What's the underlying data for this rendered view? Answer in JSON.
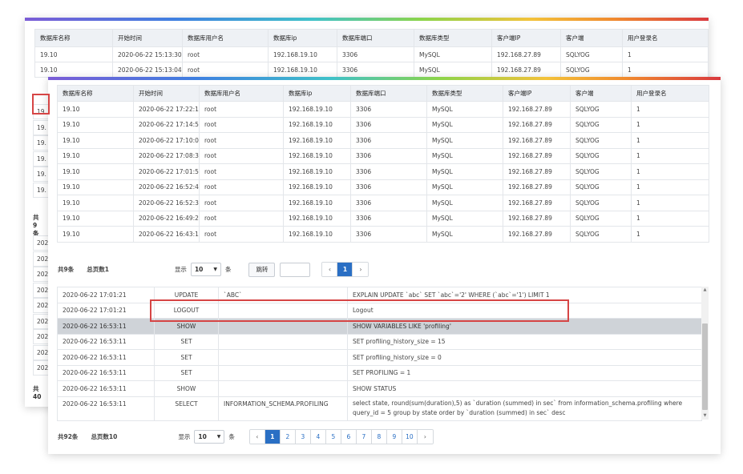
{
  "back_table": {
    "headers": [
      "数据库名称",
      "开始时间",
      "数据库用户名",
      "数据库ip",
      "数据库端口",
      "数据库类型",
      "客户端IP",
      "客户端",
      "用户登录名"
    ],
    "rows": [
      [
        "19.10",
        "2020-06-22 15:13:30",
        "root",
        "192.168.19.10",
        "3306",
        "MySQL",
        "192.168.27.89",
        "SQLYOG",
        "1"
      ],
      [
        "19.10",
        "2020-06-22 15:13:04",
        "root",
        "192.168.19.10",
        "3306",
        "MySQL",
        "192.168.27.89",
        "SQLYOG",
        "1"
      ]
    ],
    "side_cells": [
      "19.",
      "19.",
      "19.",
      "19.",
      "19.",
      "19."
    ],
    "side_total": "共9条",
    "side_lower_cells": [
      "202",
      "202",
      "202",
      "202",
      "202",
      "202",
      "202",
      "202",
      "202"
    ],
    "side_bottom_total": "共40"
  },
  "front_table": {
    "headers": [
      "数据库名称",
      "开始时间",
      "数据库用户名",
      "数据库ip",
      "数据库端口",
      "数据库类型",
      "客户端IP",
      "客户端",
      "用户登录名"
    ],
    "rows": [
      [
        "19.10",
        "2020-06-22 17:22:11",
        "root",
        "192.168.19.10",
        "3306",
        "MySQL",
        "192.168.27.89",
        "SQLYOG",
        "1"
      ],
      [
        "19.10",
        "2020-06-22 17:14:53",
        "root",
        "192.168.19.10",
        "3306",
        "MySQL",
        "192.168.27.89",
        "SQLYOG",
        "1"
      ],
      [
        "19.10",
        "2020-06-22 17:10:05",
        "root",
        "192.168.19.10",
        "3306",
        "MySQL",
        "192.168.27.89",
        "SQLYOG",
        "1"
      ],
      [
        "19.10",
        "2020-06-22 17:08:33",
        "root",
        "192.168.19.10",
        "3306",
        "MySQL",
        "192.168.27.89",
        "SQLYOG",
        "1"
      ],
      [
        "19.10",
        "2020-06-22 17:01:53",
        "root",
        "192.168.19.10",
        "3306",
        "MySQL",
        "192.168.27.89",
        "SQLYOG",
        "1"
      ],
      [
        "19.10",
        "2020-06-22 16:52:44",
        "root",
        "192.168.19.10",
        "3306",
        "MySQL",
        "192.168.27.89",
        "SQLYOG",
        "1"
      ],
      [
        "19.10",
        "2020-06-22 16:52:35",
        "root",
        "192.168.19.10",
        "3306",
        "MySQL",
        "192.168.27.89",
        "SQLYOG",
        "1"
      ],
      [
        "19.10",
        "2020-06-22 16:49:29",
        "root",
        "192.168.19.10",
        "3306",
        "MySQL",
        "192.168.27.89",
        "SQLYOG",
        "1"
      ],
      [
        "19.10",
        "2020-06-22 16:43:10",
        "root",
        "192.168.19.10",
        "3306",
        "MySQL",
        "192.168.27.89",
        "SQLYOG",
        "1"
      ]
    ]
  },
  "pager1": {
    "total": "共9条",
    "pages_total": "总页数1",
    "show_label": "显示",
    "page_size": "10",
    "unit": "条",
    "jump_label": "跳转",
    "prev": "‹",
    "next": "›",
    "pages": [
      "1"
    ]
  },
  "log_table": {
    "rows": [
      [
        "2020-06-22 17:01:21",
        "UPDATE",
        "`ABC`",
        "EXPLAIN UPDATE `abc` SET `abc`='2' WHERE (`abc`='1') LIMIT 1"
      ],
      [
        "2020-06-22 17:01:21",
        "LOGOUT",
        "",
        "Logout"
      ],
      [
        "2020-06-22 16:53:11",
        "SHOW",
        "",
        "SHOW VARIABLES LIKE 'profiling'"
      ],
      [
        "2020-06-22 16:53:11",
        "SET",
        "",
        "SET profiling_history_size = 15"
      ],
      [
        "2020-06-22 16:53:11",
        "SET",
        "",
        "SET profiling_history_size = 0"
      ],
      [
        "2020-06-22 16:53:11",
        "SET",
        "",
        "SET PROFILING = 1"
      ],
      [
        "2020-06-22 16:53:11",
        "SHOW",
        "",
        "SHOW STATUS"
      ],
      [
        "2020-06-22 16:53:11",
        "SELECT",
        "INFORMATION_SCHEMA.PROFILING",
        "select state, round(sum(duration),5) as `duration (summed) in sec` from information_schema.profiling where query_id = 5 group by state order by `duration (summed) in sec` desc"
      ]
    ]
  },
  "pager2": {
    "total": "共92条",
    "pages_total": "总页数10",
    "show_label": "显示",
    "page_size": "10",
    "unit": "条",
    "prev": "‹",
    "next": "›",
    "pages": [
      "1",
      "2",
      "3",
      "4",
      "5",
      "6",
      "7",
      "8",
      "9",
      "10"
    ]
  },
  "colors": {
    "accent": "#2a6fc4",
    "highlight_box": "#d64545",
    "selected_row": "#cfd3d8"
  }
}
